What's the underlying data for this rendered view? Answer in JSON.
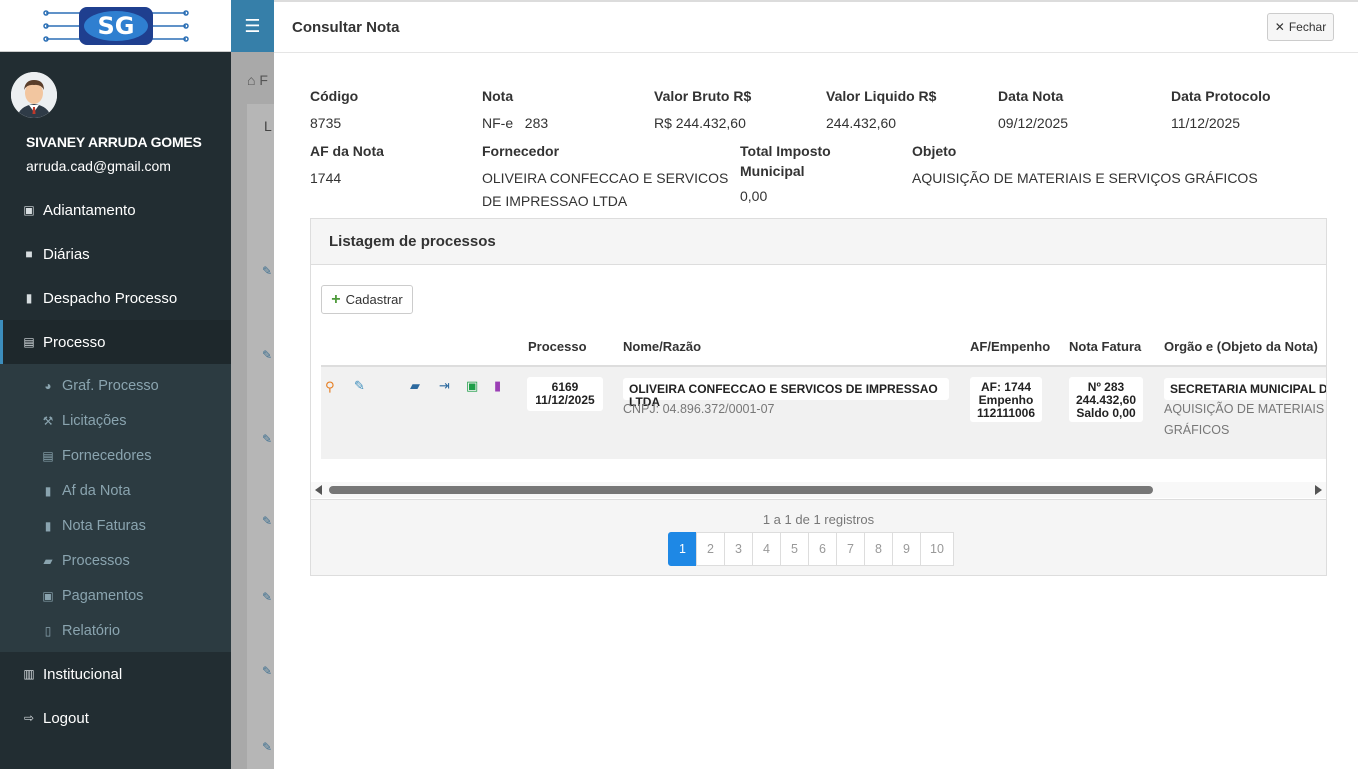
{
  "user": {
    "name": "SIVANEY ARRUDA GOMES",
    "email": "arruda.cad@gmail.com"
  },
  "menu": {
    "adiantamento": "Adiantamento",
    "diarias": "Diárias",
    "despacho": "Despacho Processo",
    "processo": "Processo",
    "sub": [
      "Graf. Processo",
      "Licitações",
      "Fornecedores",
      "Af da Nota",
      "Nota Faturas",
      "Processos",
      "Pagamentos",
      "Relatório"
    ],
    "institucional": "Institucional",
    "logout": "Logout"
  },
  "background": {
    "breadcrumb_initial": "F",
    "box_initial": "L"
  },
  "modal": {
    "title": "Consultar Nota",
    "close_label": "Fechar",
    "fields": {
      "codigo": {
        "label": "Código",
        "value": "8735"
      },
      "nota": {
        "label": "Nota",
        "value": "NF-e   283"
      },
      "valor_bruto": {
        "label": "Valor Bruto R$",
        "value": "R$ 244.432,60"
      },
      "valor_liquido": {
        "label": "Valor Liquido R$",
        "value": "244.432,60"
      },
      "data_nota": {
        "label": "Data Nota",
        "value": "09/12/2025"
      },
      "data_protocolo": {
        "label": "Data Protocolo",
        "value": "11/12/2025"
      },
      "af_nota": {
        "label": "AF da Nota",
        "value": "1744"
      },
      "fornecedor": {
        "label": "Fornecedor",
        "value_line1": "OLIVEIRA CONFECCAO E SERVICOS",
        "value_line2": "DE IMPRESSAO LTDA"
      },
      "imposto": {
        "label_line1": "Total Imposto",
        "label_line2": "Municipal",
        "value": "0,00"
      },
      "objeto": {
        "label": "Objeto",
        "value": "AQUISIÇÃO DE MATERIAIS E SERVIÇOS GRÁFICOS"
      }
    },
    "panel": {
      "title": "Listagem de processos",
      "add_label": "Cadastrar",
      "headers": [
        "Processo",
        "Nome/Razão",
        "AF/Empenho",
        "Nota Fatura",
        "Orgão e (Objeto da Nota)"
      ],
      "row": {
        "processo_num": "6169",
        "processo_data": "11/12/2025",
        "nome": "OLIVEIRA CONFECCAO E SERVICOS DE IMPRESSAO LTDA",
        "cnpj": "CNPJ: 04.896.372/0001-07",
        "af": "AF: 1744",
        "empenho_label": "Empenho",
        "empenho_num": "112111006",
        "nota_num": "Nº 283",
        "nota_valor": "244.432,60",
        "nota_saldo": "Saldo 0,00",
        "orgao": "SECRETARIA MUNICIPAL DE",
        "objeto_line1": "AQUISIÇÃO DE MATERIAIS E",
        "objeto_line2": "GRÁFICOS"
      },
      "records_info": "1 a 1 de 1 registros",
      "pages": [
        "1",
        "2",
        "3",
        "4",
        "5",
        "6",
        "7",
        "8",
        "9",
        "10"
      ],
      "active_page": "1"
    }
  },
  "colors": {
    "sidebar_bg": "#222d32",
    "toggle_bg": "#367fa9",
    "active_page": "#1e88e5",
    "accent_green": "#4d9a3a"
  }
}
